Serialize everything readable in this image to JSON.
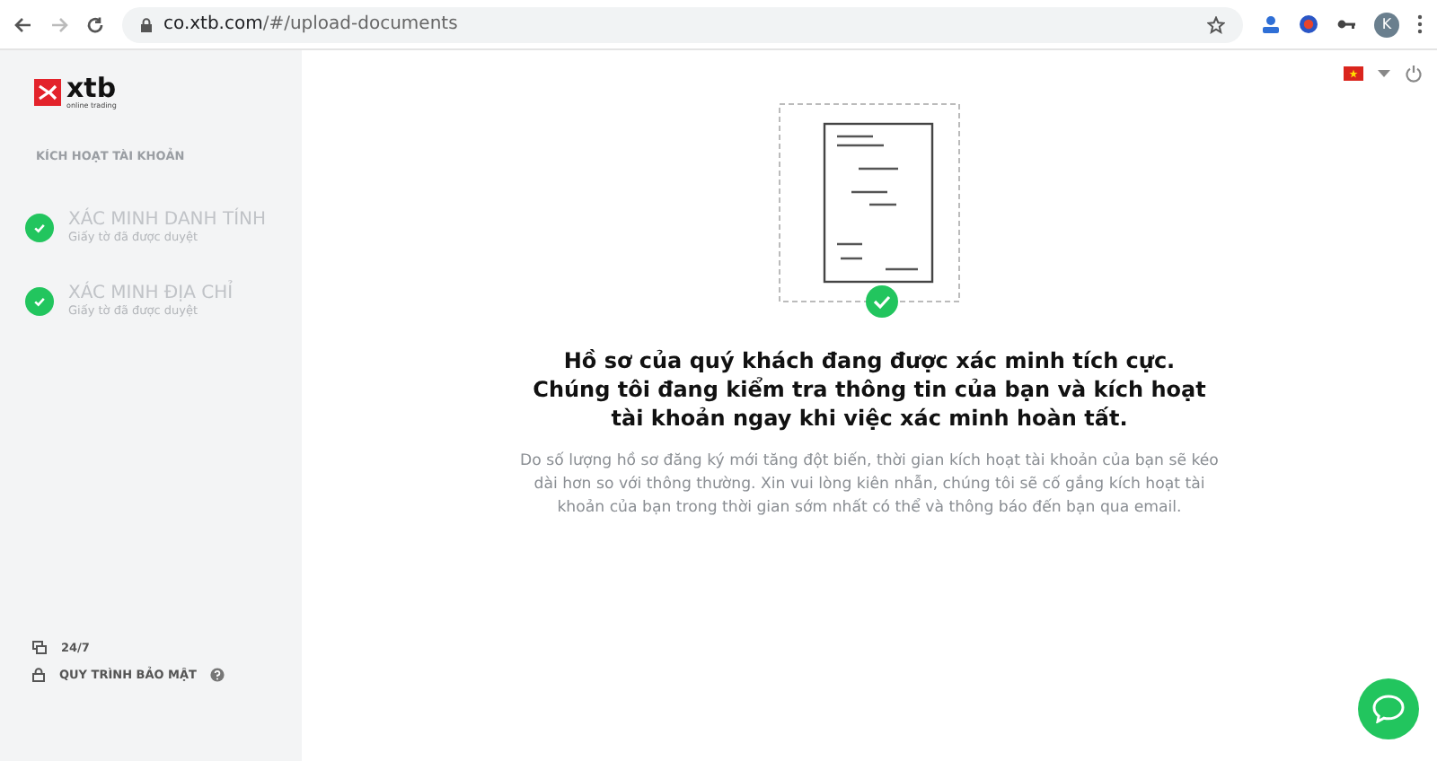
{
  "browser": {
    "url_host": "co.xtb.com",
    "url_path": "/#/upload-documents",
    "profile_initial": "K"
  },
  "sidebar": {
    "logo": {
      "name": "xtb",
      "tagline": "online trading"
    },
    "section_title": "KÍCH HOẠT TÀI KHOẢN",
    "steps": [
      {
        "title": "XÁC MINH DANH TÍNH",
        "subtitle": "Giấy tờ đã được duyệt",
        "completed": true
      },
      {
        "title": "XÁC MINH ĐỊA CHỈ",
        "subtitle": "Giấy tờ đã được duyệt",
        "completed": true
      }
    ],
    "footer": [
      {
        "kind": "support",
        "label": "24/7"
      },
      {
        "kind": "security",
        "label": "QUY TRÌNH BẢO MẬT"
      }
    ]
  },
  "main": {
    "heading": "Hồ sơ của quý khách đang được xác minh tích cực. Chúng tôi đang kiểm tra thông tin của bạn và kích hoạt tài khoản ngay khi việc xác minh hoàn tất.",
    "body": "Do số lượng hồ sơ đăng ký mới tăng đột biến, thời gian kích hoạt tài khoản của bạn sẽ kéo dài hơn so với thông thường. Xin vui lòng kiên nhẫn, chúng tôi sẽ cố gắng kích hoạt tài khoản của bạn trong thời gian sớm nhất có thể và thông báo đến bạn qua email."
  }
}
